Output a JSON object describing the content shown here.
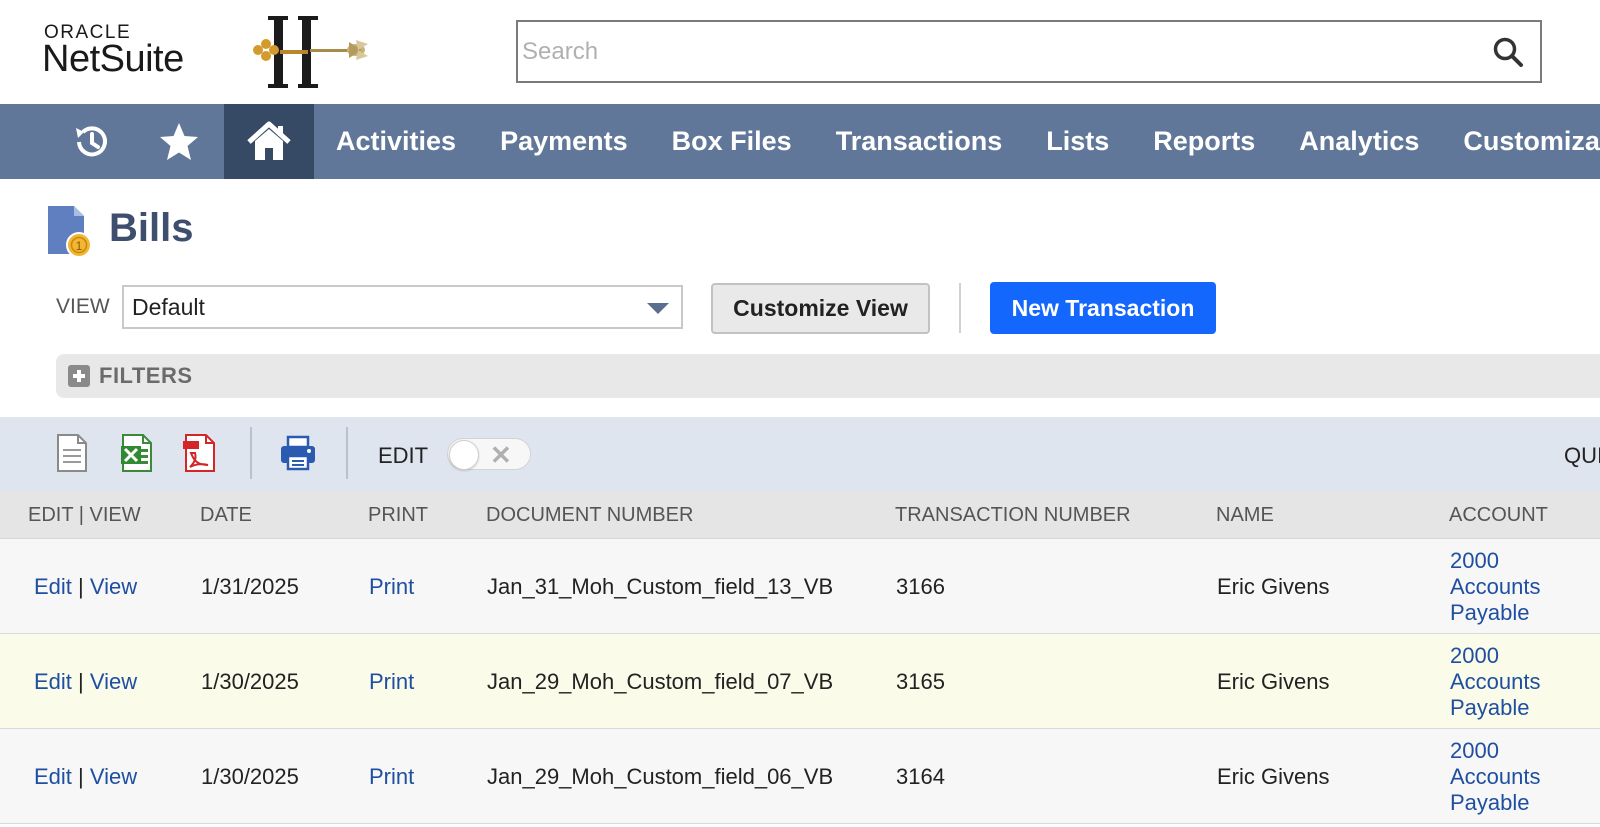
{
  "header": {
    "logo_top": "ORACLE",
    "logo_bottom": "NetSuite",
    "search_placeholder": "Search"
  },
  "nav": {
    "icons": [
      "history-icon",
      "star-icon",
      "home-icon"
    ],
    "items": [
      "Activities",
      "Payments",
      "Box Files",
      "Transactions",
      "Lists",
      "Reports",
      "Analytics",
      "Customization"
    ]
  },
  "page": {
    "title": "Bills",
    "view_label": "VIEW",
    "view_selected": "Default",
    "customize_view_label": "Customize View",
    "new_transaction_label": "New Transaction",
    "filters_label": "FILTERS"
  },
  "toolbar": {
    "edit_label": "EDIT",
    "edit_toggle_on": false,
    "quick_label": "QUI"
  },
  "table": {
    "columns": [
      "EDIT | VIEW",
      "DATE",
      "PRINT",
      "DOCUMENT NUMBER",
      "TRANSACTION NUMBER",
      "NAME",
      "ACCOUNT"
    ],
    "rows": [
      {
        "edit": "Edit",
        "sep": "|",
        "view": "View",
        "date": "1/31/2025",
        "print": "Print",
        "document_number": "Jan_31_Moh_Custom_field_13_VB",
        "transaction_number": "3166",
        "name": "Eric Givens",
        "account": [
          "2000",
          "Accounts",
          "Payable"
        ]
      },
      {
        "edit": "Edit",
        "sep": "|",
        "view": "View",
        "date": "1/30/2025",
        "print": "Print",
        "document_number": "Jan_29_Moh_Custom_field_07_VB",
        "transaction_number": "3165",
        "name": "Eric Givens",
        "account": [
          "2000",
          "Accounts",
          "Payable"
        ]
      },
      {
        "edit": "Edit",
        "sep": "|",
        "view": "View",
        "date": "1/30/2025",
        "print": "Print",
        "document_number": "Jan_29_Moh_Custom_field_06_VB",
        "transaction_number": "3164",
        "name": "Eric Givens",
        "account": [
          "2000",
          "Accounts",
          "Payable"
        ]
      }
    ]
  },
  "colors": {
    "nav_bg": "#607799",
    "nav_home_bg": "#364a66",
    "primary_button": "#1467fc",
    "link": "#1f4fa0",
    "title": "#3e4f6d"
  }
}
